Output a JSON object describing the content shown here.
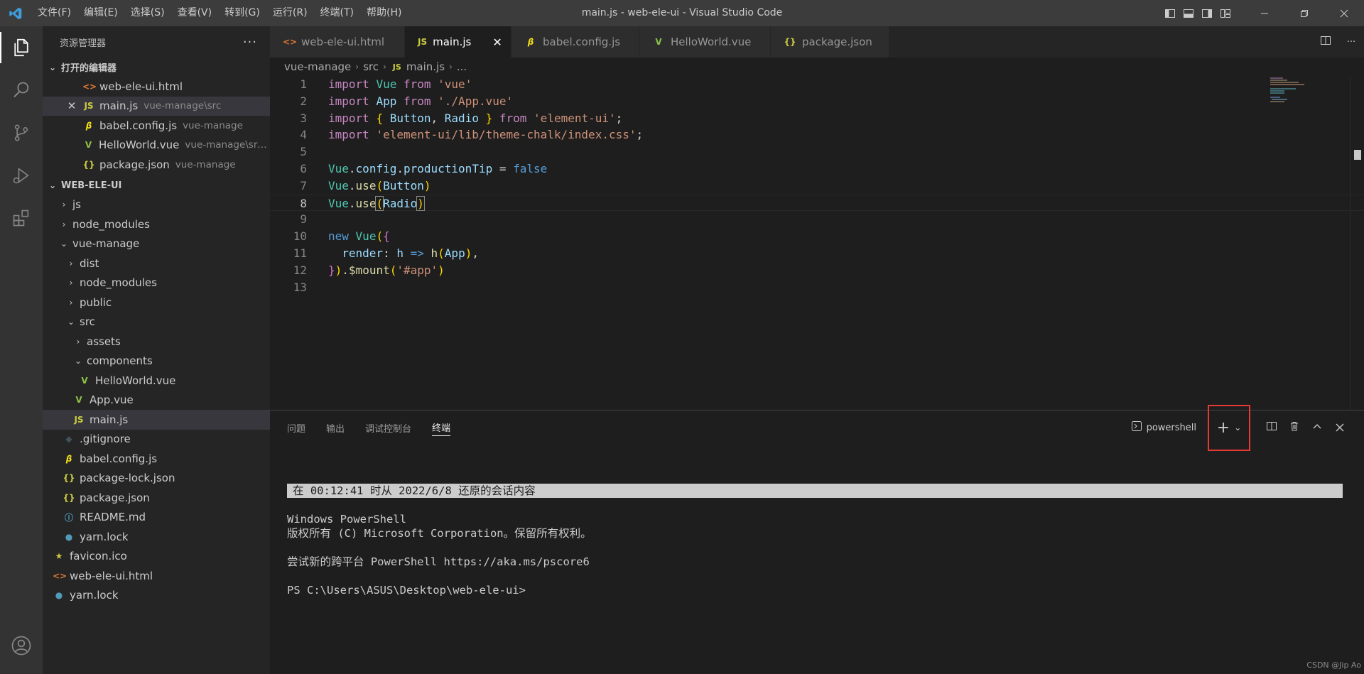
{
  "titlebar": {
    "menu": [
      "文件(F)",
      "编辑(E)",
      "选择(S)",
      "查看(V)",
      "转到(G)",
      "运行(R)",
      "终端(T)",
      "帮助(H)"
    ],
    "title": "main.js - web-ele-ui - Visual Studio Code"
  },
  "sidebar": {
    "title": "资源管理器",
    "more": "···",
    "open_editors_header": "打开的编辑器",
    "open_editors": [
      {
        "name": "web-ele-ui.html",
        "desc": ""
      },
      {
        "name": "main.js",
        "desc": "vue-manage\\src"
      },
      {
        "name": "babel.config.js",
        "desc": "vue-manage"
      },
      {
        "name": "HelloWorld.vue",
        "desc": "vue-manage\\src\\..."
      },
      {
        "name": "package.json",
        "desc": "vue-manage"
      }
    ],
    "workspace_header": "WEB-ELE-UI",
    "tree": [
      "js",
      "node_modules",
      "vue-manage",
      "dist",
      "node_modules",
      "public",
      "src",
      "assets",
      "components",
      "HelloWorld.vue",
      "App.vue",
      "main.js",
      ".gitignore",
      "babel.config.js",
      "package-lock.json",
      "package.json",
      "README.md",
      "yarn.lock",
      "favicon.ico",
      "web-ele-ui.html",
      "yarn.lock"
    ]
  },
  "tabs": [
    {
      "label": "web-ele-ui.html"
    },
    {
      "label": "main.js"
    },
    {
      "label": "babel.config.js"
    },
    {
      "label": "HelloWorld.vue"
    },
    {
      "label": "package.json"
    }
  ],
  "breadcrumb": [
    "vue-manage",
    "src",
    "main.js",
    "..."
  ],
  "editor": {
    "line_numbers": [
      "1",
      "2",
      "3",
      "4",
      "5",
      "6",
      "7",
      "8",
      "9",
      "10",
      "11",
      "12",
      "13"
    ],
    "current_line": 8
  },
  "panel": {
    "tabs": [
      "问题",
      "输出",
      "调试控制台",
      "终端"
    ],
    "active_tab": "终端",
    "terminal_name": "powershell",
    "lines": {
      "restore": "在 00:12:41 时从 2022/6/8 还原的会话内容",
      "l1": "Windows PowerShell",
      "l2": "版权所有 (C) Microsoft Corporation。保留所有权利。",
      "l3": "尝试新的跨平台 PowerShell https://aka.ms/pscore6",
      "l4": "PS C:\\Users\\ASUS\\Desktop\\web-ele-ui>"
    }
  },
  "watermark": "CSDN @Jip Ao",
  "colors": {
    "accent": "#007acc",
    "highlight_box": "#e53935"
  }
}
